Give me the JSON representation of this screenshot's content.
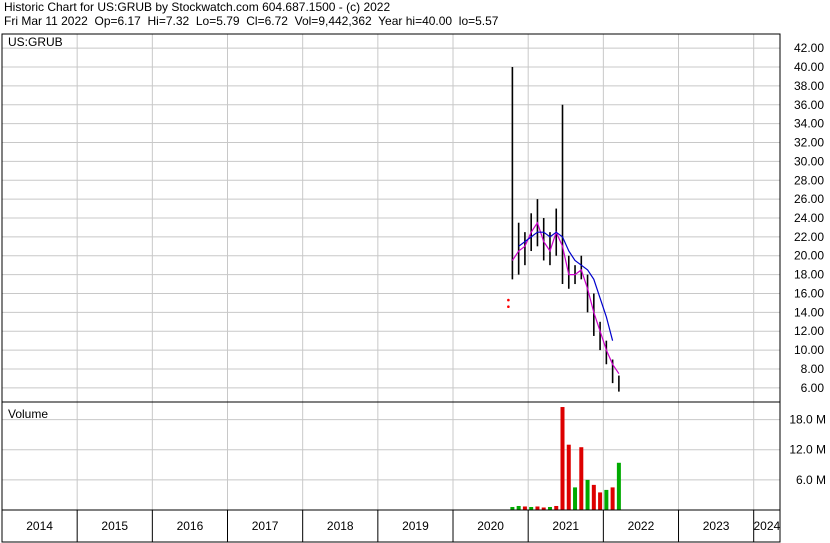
{
  "header": {
    "line1": "Historic Chart for US:GRUB by Stockwatch.com 604.687.1500 - (c) 2022",
    "line2": "Fri Mar 11 2022  Op=6.17  Hi=7.32  Lo=5.79  Cl=6.72  Vol=9,442,362  Year hi=40.00  lo=5.57"
  },
  "chart_data": [
    {
      "type": "line",
      "title": "US:GRUB",
      "ylim": [
        4.5,
        43.5
      ],
      "yticks": [
        "42.00",
        "40.00",
        "38.00",
        "36.00",
        "34.00",
        "32.00",
        "30.00",
        "28.00",
        "26.00",
        "24.00",
        "22.00",
        "20.00",
        "18.00",
        "16.00",
        "14.00",
        "12.00",
        "10.00",
        "8.00",
        "6.00"
      ],
      "xticks": [
        "2014",
        "2015",
        "2016",
        "2017",
        "2018",
        "2019",
        "2020",
        "2021",
        "2022",
        "2023",
        "2024"
      ],
      "grid": true,
      "colors": {
        "price_bar": "#000000",
        "ma_short": "#cc00cc",
        "ma_long": "#0000cc",
        "early_dots": "#ff0000"
      },
      "series": [
        {
          "kind": "price-bars",
          "x": [
            "2020-10",
            "2020-11",
            "2020-12",
            "2021-01",
            "2021-02",
            "2021-03",
            "2021-04",
            "2021-05",
            "2021-06",
            "2021-07",
            "2021-08",
            "2021-09",
            "2021-10",
            "2021-11",
            "2021-12",
            "2022-01",
            "2022-02",
            "2022-03"
          ],
          "high": [
            40.0,
            23.5,
            22.5,
            24.5,
            26.0,
            24.0,
            22.5,
            25.0,
            36.0,
            20.0,
            19.0,
            20.0,
            18.0,
            16.0,
            13.0,
            11.0,
            9.0,
            7.3
          ],
          "low": [
            17.5,
            18.0,
            19.0,
            20.5,
            21.0,
            19.5,
            19.0,
            20.0,
            17.0,
            16.5,
            17.0,
            17.5,
            14.0,
            11.5,
            10.0,
            8.5,
            6.5,
            5.6
          ]
        },
        {
          "kind": "moving-average-short",
          "x": [
            "2020-10",
            "2020-11",
            "2020-12",
            "2021-01",
            "2021-02",
            "2021-03",
            "2021-04",
            "2021-05",
            "2021-06",
            "2021-07",
            "2021-08",
            "2021-09",
            "2021-10",
            "2021-11",
            "2021-12",
            "2022-01",
            "2022-02",
            "2022-03"
          ],
          "values": [
            19.5,
            20.5,
            21.0,
            22.5,
            23.5,
            21.5,
            20.5,
            22.5,
            21.0,
            18.0,
            18.0,
            18.5,
            16.5,
            14.0,
            12.0,
            10.0,
            8.5,
            7.5
          ]
        },
        {
          "kind": "moving-average-long",
          "x": [
            "2020-11",
            "2020-12",
            "2021-01",
            "2021-02",
            "2021-03",
            "2021-04",
            "2021-05",
            "2021-06",
            "2021-07",
            "2021-08",
            "2021-09",
            "2021-10",
            "2021-11",
            "2021-12",
            "2022-01",
            "2022-02"
          ],
          "values": [
            21.0,
            21.5,
            22.0,
            22.5,
            22.5,
            22.0,
            22.5,
            22.0,
            20.5,
            19.5,
            19.0,
            18.5,
            17.5,
            15.5,
            13.5,
            11.0
          ]
        },
        {
          "kind": "early-dots",
          "x": [
            "2020-10",
            "2020-10"
          ],
          "values": [
            15.3,
            14.6
          ]
        }
      ]
    },
    {
      "type": "bar",
      "title": "Volume",
      "ylim": [
        0,
        21.5
      ],
      "yticks": [
        "18.0 M",
        "12.0 M",
        "6.0 M"
      ],
      "grid": true,
      "colors": {
        "up": "#00aa00",
        "down": "#dd0000"
      },
      "x": [
        "2020-10",
        "2020-11",
        "2020-12",
        "2021-01",
        "2021-02",
        "2021-03",
        "2021-04",
        "2021-05",
        "2021-06",
        "2021-07",
        "2021-08",
        "2021-09",
        "2021-10",
        "2021-11",
        "2021-12",
        "2022-01",
        "2022-02",
        "2022-03"
      ],
      "values": [
        0.6,
        0.8,
        0.7,
        0.6,
        0.7,
        0.5,
        0.6,
        0.8,
        20.5,
        13.0,
        4.5,
        12.5,
        6.0,
        5.0,
        3.5,
        4.0,
        4.5,
        9.4
      ],
      "direction": [
        "up",
        "up",
        "down",
        "up",
        "down",
        "down",
        "up",
        "down",
        "down",
        "down",
        "up",
        "down",
        "up",
        "down",
        "down",
        "up",
        "down",
        "up"
      ]
    }
  ]
}
